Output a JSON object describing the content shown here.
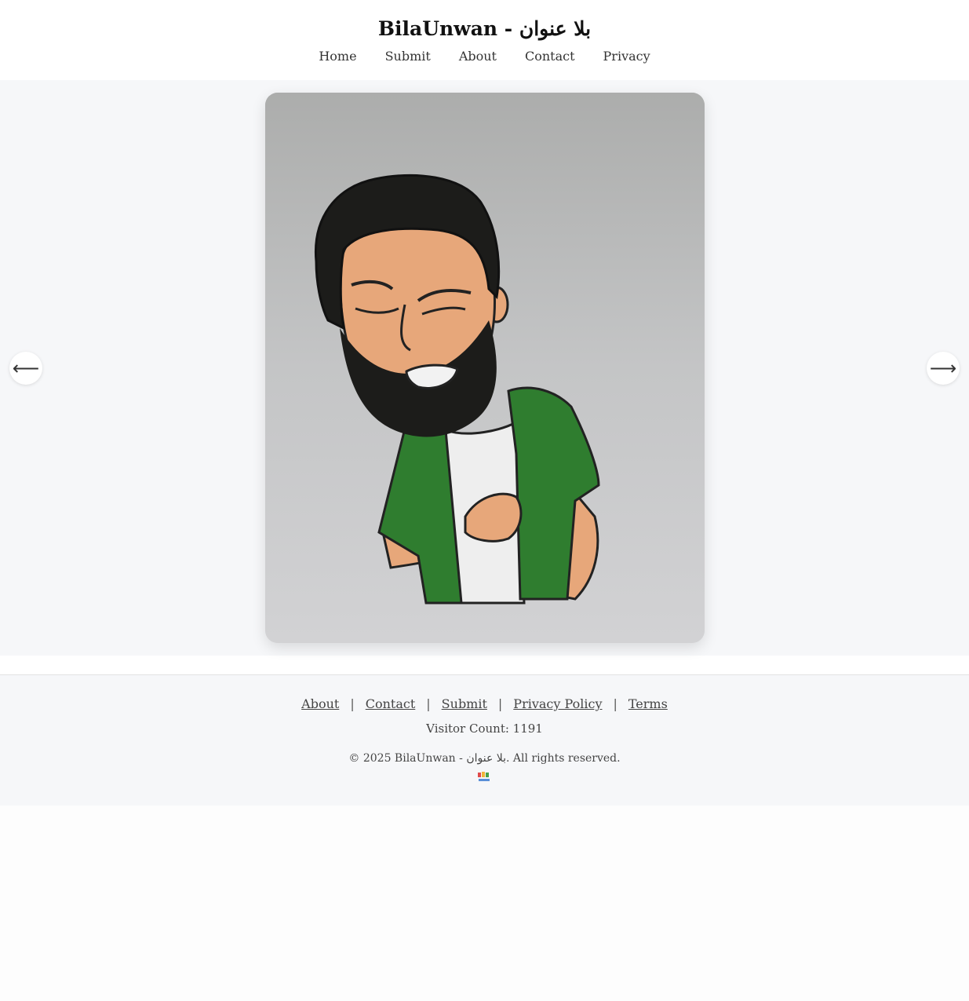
{
  "site": {
    "title": "BilaUnwan - بلا عنوان"
  },
  "nav": {
    "items": [
      {
        "label": "Home"
      },
      {
        "label": "Submit"
      },
      {
        "label": "About"
      },
      {
        "label": "Contact"
      },
      {
        "label": "Privacy"
      }
    ]
  },
  "gallery": {
    "prev_icon": "⟵",
    "next_icon": "⟶"
  },
  "footer": {
    "links": [
      {
        "label": "About"
      },
      {
        "label": "Contact"
      },
      {
        "label": "Submit"
      },
      {
        "label": "Privacy Policy"
      },
      {
        "label": "Terms"
      }
    ],
    "separator": "|",
    "visitor_count": "Visitor Count: 1191",
    "copyright": "© 2025 BilaUnwan - بلا عنوان. All rights reserved."
  },
  "colors": {
    "page_bg": "#fdfdfd",
    "section_bg": "#f6f7f9",
    "text": "#333333",
    "shirt_green": "#2f7d2f",
    "skin": "#e7a77a",
    "hair": "#1c1c1a"
  }
}
